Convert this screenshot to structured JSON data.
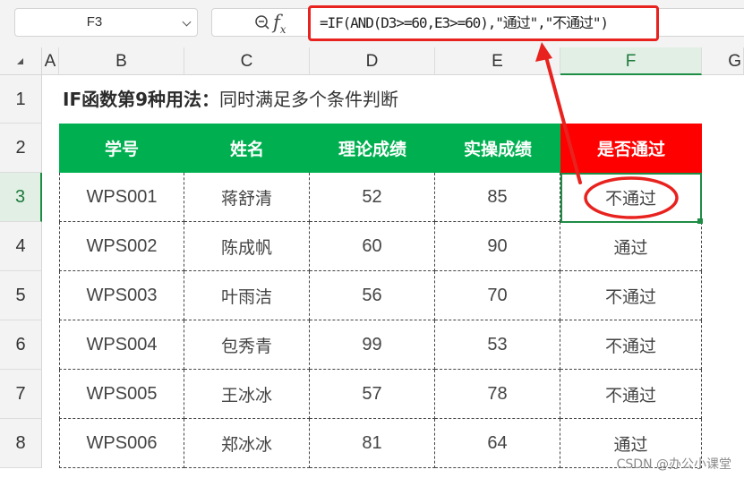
{
  "name_box": {
    "value": "F3"
  },
  "formula_bar": {
    "formula": "=IF(AND(D3>=60,E3>=60),\"通过\",\"不通过\")",
    "fx_label": "f",
    "fx_sub": "x"
  },
  "columns": [
    "A",
    "B",
    "C",
    "D",
    "E",
    "F",
    "G"
  ],
  "rows": [
    "1",
    "2",
    "3",
    "4",
    "5",
    "6",
    "7",
    "8"
  ],
  "title": {
    "bold": "IF函数第9种用法：",
    "rest": "同时满足多个条件判断"
  },
  "table": {
    "headers": [
      "学号",
      "姓名",
      "理论成绩",
      "实操成绩",
      "是否通过"
    ],
    "rows": [
      [
        "WPS001",
        "蒋舒清",
        "52",
        "85",
        "不通过"
      ],
      [
        "WPS002",
        "陈成帆",
        "60",
        "90",
        "通过"
      ],
      [
        "WPS003",
        "叶雨洁",
        "56",
        "70",
        "不通过"
      ],
      [
        "WPS004",
        "包秀青",
        "99",
        "53",
        "不通过"
      ],
      [
        "WPS005",
        "王冰冰",
        "57",
        "78",
        "不通过"
      ],
      [
        "WPS006",
        "郑冰冰",
        "81",
        "64",
        "通过"
      ]
    ]
  },
  "colors": {
    "header_green": "#00b050",
    "header_red": "#ff0000",
    "annotation_red": "#e8221e",
    "selection": "#1e8c45"
  },
  "watermark": "CSDN @办公小课堂"
}
